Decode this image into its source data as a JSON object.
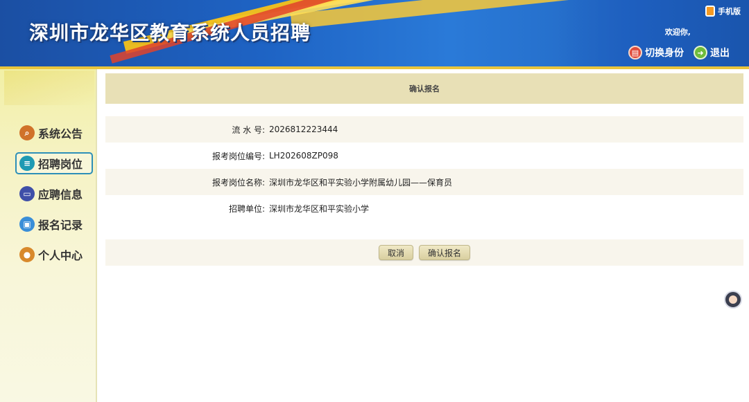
{
  "header": {
    "title": "深圳市龙华区教育系统人员招聘",
    "mobile_link": "手机版",
    "welcome": "欢迎你,",
    "switch_identity": "切换身份",
    "logout": "退出"
  },
  "sidebar": {
    "items": [
      {
        "label": "系统公告",
        "icon": "search-icon"
      },
      {
        "label": "招聘岗位",
        "icon": "list-icon",
        "active": true
      },
      {
        "label": "应聘信息",
        "icon": "id-card-icon"
      },
      {
        "label": "报名记录",
        "icon": "monitor-icon"
      },
      {
        "label": "个人中心",
        "icon": "user-icon"
      }
    ]
  },
  "main": {
    "title": "确认报名",
    "fields": [
      {
        "label": "流 水 号:",
        "value": "2026812223444"
      },
      {
        "label": "报考岗位编号:",
        "value": "LH202608ZP098"
      },
      {
        "label": "报考岗位名称:",
        "value": "深圳市龙华区和平实验小学附属幼儿园——保育员"
      },
      {
        "label": "招聘单位:",
        "value": "深圳市龙华区和平实验小学"
      }
    ],
    "cancel_label": "取消",
    "confirm_label": "确认报名"
  },
  "colors": {
    "header_blue": "#1e63c4",
    "accent_yellow": "#f6c21a",
    "panel_title_bg": "#e8e0b6",
    "row_alt_bg": "#f8f5ec",
    "active_border": "#2d8fb8"
  }
}
